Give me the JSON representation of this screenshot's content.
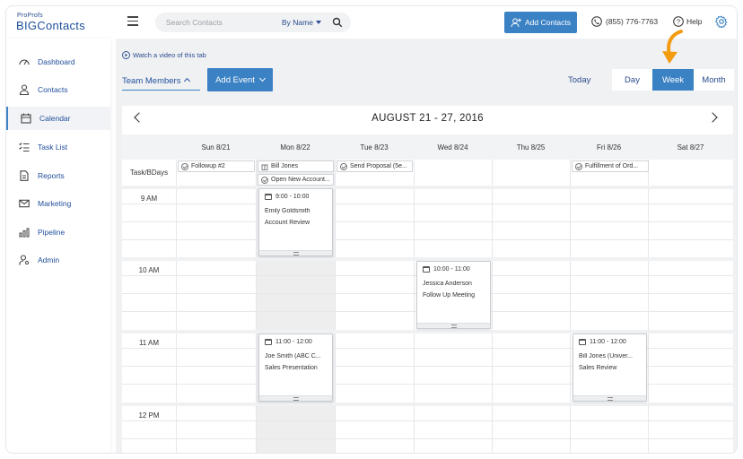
{
  "brand": {
    "small": "ProProfs",
    "big": "BIGContacts"
  },
  "search": {
    "placeholder": "Search Contacts",
    "filter": "By Name"
  },
  "header": {
    "add_contacts": "Add Contacts",
    "phone": "(855) 776-7763",
    "help": "Help"
  },
  "sidebar": {
    "items": [
      {
        "label": "Dashboard",
        "icon": "dashboard-icon"
      },
      {
        "label": "Contacts",
        "icon": "person-icon"
      },
      {
        "label": "Calendar",
        "icon": "calendar-icon",
        "active": true
      },
      {
        "label": "Task List",
        "icon": "tasklist-icon"
      },
      {
        "label": "Reports",
        "icon": "report-icon"
      },
      {
        "label": "Marketing",
        "icon": "mail-icon"
      },
      {
        "label": "Pipeline",
        "icon": "pipeline-icon"
      },
      {
        "label": "Admin",
        "icon": "admin-icon"
      }
    ]
  },
  "toolbar": {
    "watch": "Watch a video of this tab",
    "team": "Team Members",
    "add_event": "Add Event",
    "today": "Today",
    "views": [
      "Day",
      "Week",
      "Month"
    ],
    "active_view": "Week"
  },
  "calendar": {
    "range": "AUGUST 21 - 27, 2016",
    "days": [
      "Sun 8/21",
      "Mon 8/22",
      "Tue 8/23",
      "Wed 8/24",
      "Thu 8/25",
      "Fri 8/26",
      "Sat 8/27"
    ],
    "task_row_label": "Task/BDays",
    "hours": [
      "9 AM",
      "10 AM",
      "11 AM",
      "12 PM"
    ],
    "tasks": {
      "sun": "Followup #2",
      "mon_bday": "Bill Jones",
      "mon_task": "Open New Account...",
      "tue": "Send Proposal (5e...",
      "fri": "Fulfillment of Ord..."
    },
    "events": {
      "e1": {
        "time": "9:00 - 10:00",
        "name": "Emily Goldsmith",
        "subject": "Account Review"
      },
      "e2": {
        "time": "10:00 - 11:00",
        "name": "Jessica Anderson",
        "subject": "Follow Up Meeting"
      },
      "e3": {
        "time": "11:00 - 12:00",
        "name": "Joe Smith (ABC C...",
        "subject": "Sales Presentation"
      },
      "e4": {
        "time": "11:00 - 12:00",
        "name": "Bill Jones (Univer...",
        "subject": "Sales Review"
      }
    }
  },
  "colors": {
    "accent": "#3b82c4",
    "brand": "#1f4f9b",
    "arrow": "#f39c12"
  }
}
